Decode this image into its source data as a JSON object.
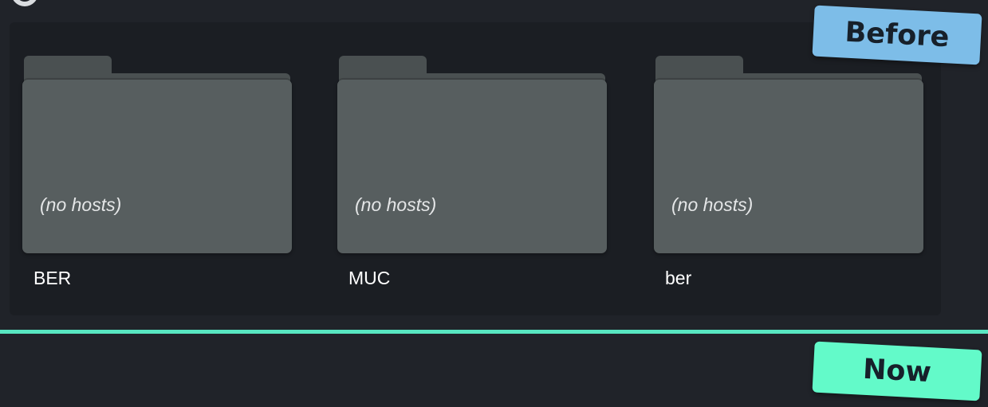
{
  "folders": [
    {
      "name": "BER",
      "note": "(no hosts)"
    },
    {
      "name": "MUC",
      "note": "(no hosts)"
    },
    {
      "name": "ber",
      "note": "(no hosts)"
    }
  ],
  "badges": {
    "before": "Before",
    "now": "Now"
  },
  "colors": {
    "background": "#202329",
    "panel": "#1b1e23",
    "folder": "#575e5f",
    "divider": "#58e6c1",
    "before_badge": "#7dbde8",
    "now_badge": "#63fac9"
  },
  "icons": {
    "folder": "folder-icon"
  }
}
